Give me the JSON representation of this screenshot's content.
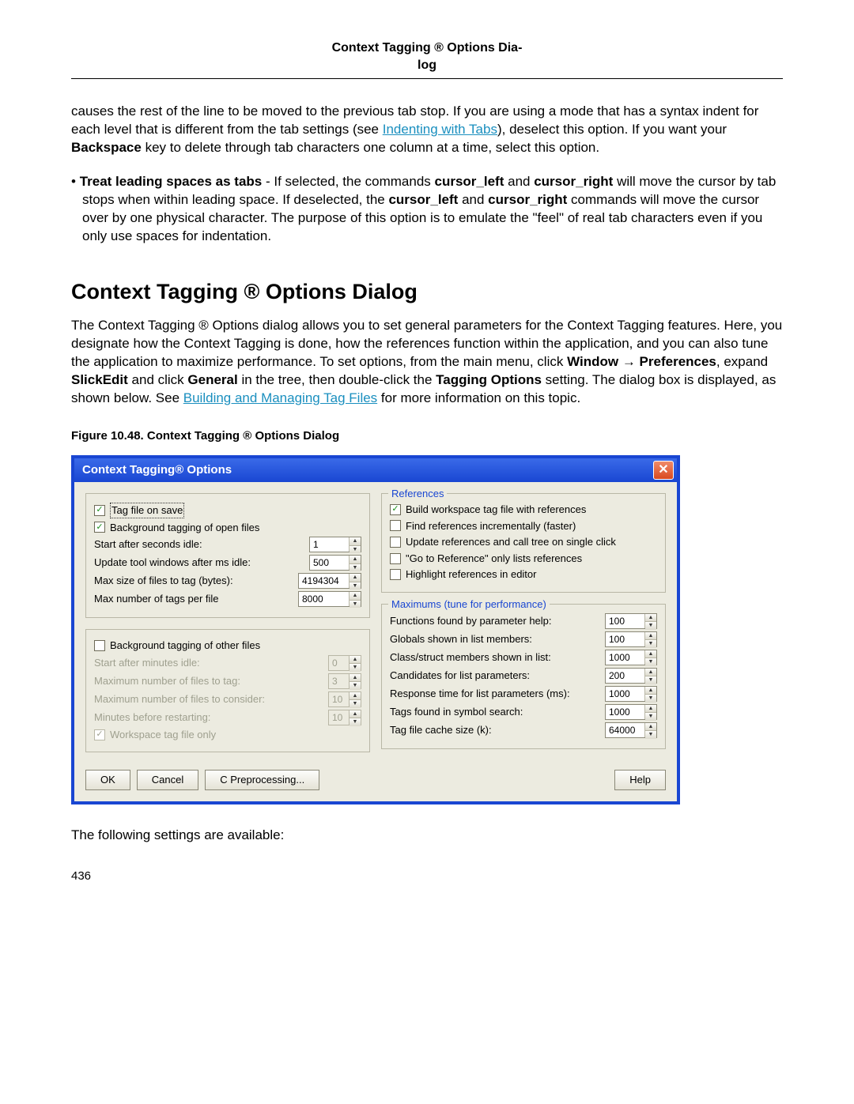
{
  "header": {
    "title1": "Context Tagging ® Options Dia-",
    "title2": "log"
  },
  "para1_a": "causes the rest of the line to be moved to the previous tab stop. If you are using a mode that has a syntax indent for each level that is different from the tab settings (see ",
  "para1_link": "Indenting with Tabs",
  "para1_b": "), deselect this option. If you want your ",
  "para1_bold": "Backspace",
  "para1_c": " key to delete through tab characters one column at a time, select this option.",
  "bullet1_bold": "Treat leading spaces as tabs",
  "bullet1_rest": " - If selected, the commands ",
  "bullet1_b1": "cursor_left",
  "bullet1_mid1": " and ",
  "bullet1_b2": "cursor_right",
  "bullet1_mid2": " will move the cursor by tab stops when within leading space. If deselected, the ",
  "bullet1_b3": "cursor_left",
  "bullet1_mid3": " and ",
  "bullet1_b4": "cursor_right",
  "bullet1_end": " commands will move the cursor over by one physical character. The purpose of this option is to emulate the \"feel\" of real tab characters even if you only use spaces for indentation.",
  "section_title": "Context Tagging ® Options Dialog",
  "intro_a": "The Context Tagging ® Options dialog allows you to set general parameters for the Context Tagging features. Here, you designate how the Context Tagging is done, how the references function within the application, and you can also tune the application to maximize performance. To set options, from the main menu, click ",
  "intro_b1": "Window",
  "intro_arrow": " → ",
  "intro_b2": "Preferences",
  "intro_mid1": ", expand ",
  "intro_b3": "SlickEdit",
  "intro_mid2": " and click ",
  "intro_b4": "General",
  "intro_mid3": " in the tree, then double-click the ",
  "intro_b5": "Tagging Options",
  "intro_mid4": " setting. The dialog box is displayed, as shown below. See ",
  "intro_link": "Building and Managing Tag Files",
  "intro_end": " for more information on this topic.",
  "figure_caption": "Figure 10.48.  Context Tagging ® Options Dialog",
  "dialog": {
    "title": "Context Tagging® Options",
    "left1": {
      "tag_on_save": "Tag file on save",
      "bg_open": "Background tagging of open files",
      "start_idle_lbl": "Start after seconds idle:",
      "start_idle_val": "1",
      "update_ms_lbl": "Update tool windows after ms idle:",
      "update_ms_val": "500",
      "max_size_lbl": "Max size of files to tag (bytes):",
      "max_size_val": "4194304",
      "max_tags_lbl": "Max number of tags per file",
      "max_tags_val": "8000"
    },
    "left2": {
      "bg_other": "Background tagging of other files",
      "start_min_lbl": "Start after minutes idle:",
      "start_min_val": "0",
      "max_files_tag_lbl": "Maximum number of files to tag:",
      "max_files_tag_val": "3",
      "max_files_cons_lbl": "Maximum number of files to consider:",
      "max_files_cons_val": "10",
      "min_restart_lbl": "Minutes before restarting:",
      "min_restart_val": "10",
      "ws_only": "Workspace tag file only"
    },
    "refs": {
      "title": "References",
      "build_ws": "Build workspace tag file with references",
      "find_inc": "Find references incrementally (faster)",
      "update_single": "Update references and call tree on single click",
      "goto_only": "\"Go to Reference\" only lists references",
      "highlight": "Highlight references in editor"
    },
    "max": {
      "title": "Maximums (tune for performance)",
      "fn_lbl": "Functions found by parameter help:",
      "fn_val": "100",
      "glob_lbl": "Globals shown in list members:",
      "glob_val": "100",
      "cls_lbl": "Class/struct members shown in list:",
      "cls_val": "1000",
      "cand_lbl": "Candidates for list parameters:",
      "cand_val": "200",
      "resp_lbl": "Response time for list parameters (ms):",
      "resp_val": "1000",
      "tags_lbl": "Tags found in symbol search:",
      "tags_val": "1000",
      "cache_lbl": "Tag file cache size (k):",
      "cache_val": "64000"
    },
    "buttons": {
      "ok": "OK",
      "cancel": "Cancel",
      "cpre": "C Preprocessing...",
      "help": "Help"
    }
  },
  "post_text": "The following settings are available:",
  "page_number": "436"
}
